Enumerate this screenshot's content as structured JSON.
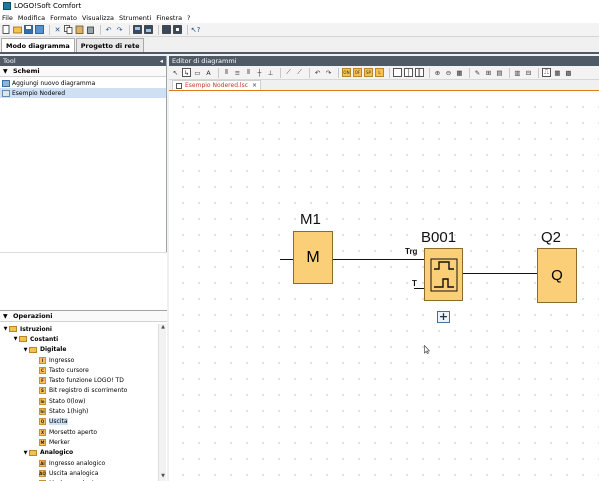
{
  "window": {
    "title": "LOGO!Soft Comfort"
  },
  "menu": [
    "File",
    "Modifica",
    "Formato",
    "Visualizza",
    "Strumenti",
    "Finestra",
    "?"
  ],
  "mode_tabs": [
    {
      "label": "Modo diagramma",
      "active": true
    },
    {
      "label": "Progetto di rete",
      "active": false
    }
  ],
  "tool_panel": {
    "header": "Tool",
    "collapse_glyph": "◂",
    "schemi": {
      "label": "Schemi",
      "items": [
        {
          "label": "Aggiungi nuovo diagramma",
          "icon": "add-diagram-icon"
        },
        {
          "label": "Esempio Nodered",
          "icon": "diagram-icon",
          "selected": true
        }
      ]
    },
    "operazioni": {
      "label": "Operazioni",
      "tree": [
        {
          "label": "Istruzioni",
          "level": 0,
          "type": "folder",
          "expanded": true,
          "bold": true
        },
        {
          "label": "Costanti",
          "level": 1,
          "type": "folder",
          "expanded": true,
          "bold": true
        },
        {
          "label": "Digitale",
          "level": 2,
          "type": "folder",
          "expanded": true,
          "bold": true
        },
        {
          "label": "Ingresso",
          "level": 3,
          "type": "block",
          "code": "I"
        },
        {
          "label": "Tasto cursore",
          "level": 3,
          "type": "block",
          "code": "C"
        },
        {
          "label": "Tasto funzione LOGO! TD",
          "level": 3,
          "type": "block",
          "code": "F"
        },
        {
          "label": "Bit registro di scorrimento",
          "level": 3,
          "type": "block",
          "code": "S"
        },
        {
          "label": "Stato 0(low)",
          "level": 3,
          "type": "block",
          "code": "lo"
        },
        {
          "label": "Stato 1(high)",
          "level": 3,
          "type": "block",
          "code": "hi"
        },
        {
          "label": "Uscita",
          "level": 3,
          "type": "block",
          "code": "Q",
          "selected": true
        },
        {
          "label": "Morsetto aperto",
          "level": 3,
          "type": "block",
          "code": "X"
        },
        {
          "label": "Merker",
          "level": 3,
          "type": "block",
          "code": "M"
        },
        {
          "label": "Analogico",
          "level": 2,
          "type": "folder",
          "expanded": true,
          "bold": true
        },
        {
          "label": "Ingresso analogico",
          "level": 3,
          "type": "block",
          "code": "AI"
        },
        {
          "label": "Uscita analogica",
          "level": 3,
          "type": "block",
          "code": "AQ"
        },
        {
          "label": "Merker analogico",
          "level": 3,
          "type": "block",
          "code": "AM"
        }
      ]
    }
  },
  "editor": {
    "header": "Editor di diagrammi",
    "tabs": [
      {
        "label": "Esempio Nodered.lsc",
        "close": "×"
      }
    ],
    "diagram": {
      "blocks": [
        {
          "id": "M1",
          "label": "M1",
          "symbol": "M"
        },
        {
          "id": "B001",
          "label": "B001",
          "inputs": [
            "Trg",
            "T"
          ],
          "expand": "+"
        },
        {
          "id": "Q2",
          "label": "Q2",
          "symbol": "Q"
        }
      ]
    }
  },
  "colors": {
    "block_fill": "#fbcf78",
    "panel_header": "#505a66",
    "tab_accent": "#e07b1c",
    "selection": "#cfe0f5"
  }
}
